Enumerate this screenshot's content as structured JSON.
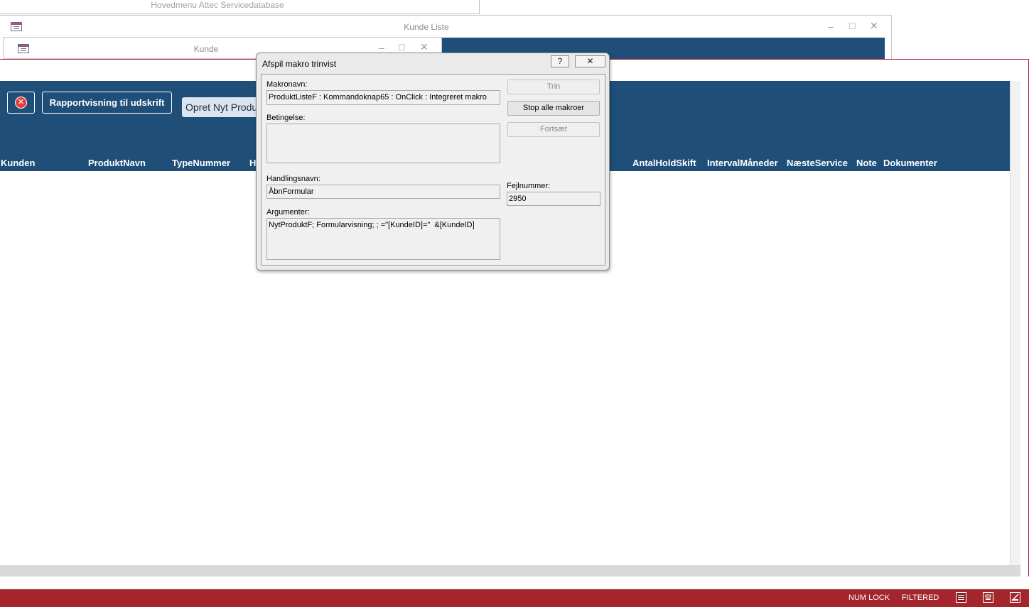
{
  "windows": {
    "main_menu": {
      "title": "Hovedmenu Attec Servicedatabase"
    },
    "kunde_liste": {
      "title": "Kunde Liste",
      "minimize": "–",
      "maximize": "□",
      "close": "✕"
    },
    "kunde": {
      "title": "Kunde",
      "minimize": "–",
      "maximize": "□",
      "close": "✕"
    }
  },
  "form": {
    "close_icon_glyph": "✕",
    "report_button": "Rapportvisning til udskrift",
    "create_button": "Opret Nyt Produ",
    "columns": {
      "kunden": "Kunden",
      "produktnavn": "ProduktNavn",
      "typenummer": "TypeNummer",
      "h": "H",
      "antalholdskift": "AntalHoldSkift",
      "intervalmaaneder": "IntervalMåneder",
      "naesteservice": "NæsteService",
      "note": "Note",
      "dokumenter": "Dokumenter"
    }
  },
  "dialog": {
    "title": "Afspil makro trinvist",
    "help_button": "?",
    "close_button": "✕",
    "macro_name_label": "Makronavn:",
    "macro_name_value": "ProduktListeF : Kommandoknap65 : OnClick : Integreret makro",
    "condition_label": "Betingelse:",
    "condition_value": "",
    "action_name_label": "Handlingsnavn:",
    "action_name_value": "ÅbnFormular",
    "arguments_label": "Argumenter:",
    "arguments_value": "NytProduktF; Formularvisning; ; =\"[KundeID]=\"  &[KundeID]",
    "error_number_label": "Fejlnummer:",
    "error_number_value": "2950",
    "step_button": "Trin",
    "stop_all_button": "Stop alle makroer",
    "continue_button": "Fortsæt"
  },
  "statusbar": {
    "num_lock": "NUM LOCK",
    "filtered": "FILTERED",
    "view_icons": [
      "form-view-icon",
      "layout-view-icon",
      "design-view-icon"
    ]
  },
  "colors": {
    "header_navy": "#1f4e79",
    "statusbar_red": "#a4262c",
    "close_red": "#e04040"
  }
}
